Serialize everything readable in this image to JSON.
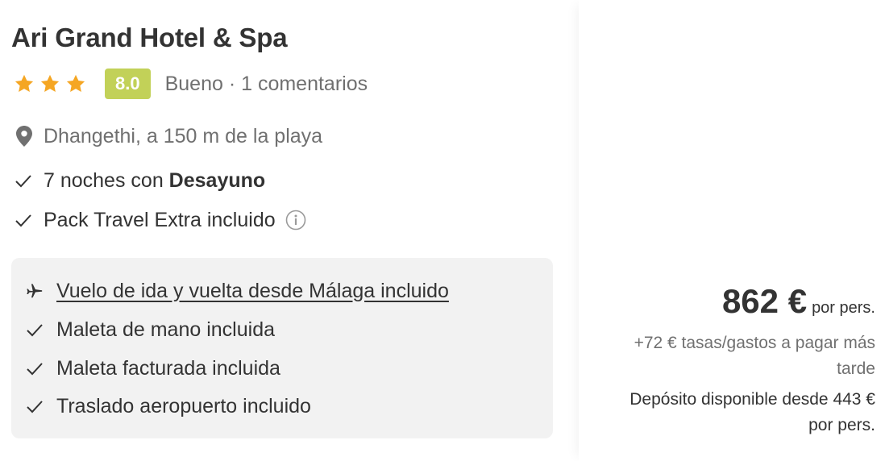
{
  "hotel": {
    "name": "Ari Grand Hotel & Spa",
    "stars": 3,
    "score": "8.0",
    "review_summary": "Bueno · 1 comentarios",
    "location": "Dhangethi, a 150 m de la playa",
    "features": {
      "nights_prefix": "7 noches con ",
      "board": "Desayuno",
      "pack": "Pack Travel Extra incluido"
    }
  },
  "included": {
    "flight": "Vuelo de ida y vuelta desde Málaga incluido",
    "items": [
      "Maleta de mano incluida",
      "Maleta facturada incluida",
      "Traslado aeropuerto incluido"
    ]
  },
  "pricing": {
    "price": "862 €",
    "per_person": "por pers.",
    "taxes": "+72 € tasas/gastos a pagar más tarde",
    "deposit": "Depósito disponible desde 443 € por pers."
  },
  "colors": {
    "star": "#f5a623",
    "score_badge": "#c2d158",
    "box_background": "#f2f2f2"
  },
  "icons": [
    "star-icon",
    "location-pin-icon",
    "check-icon",
    "info-icon",
    "airplane-icon"
  ]
}
